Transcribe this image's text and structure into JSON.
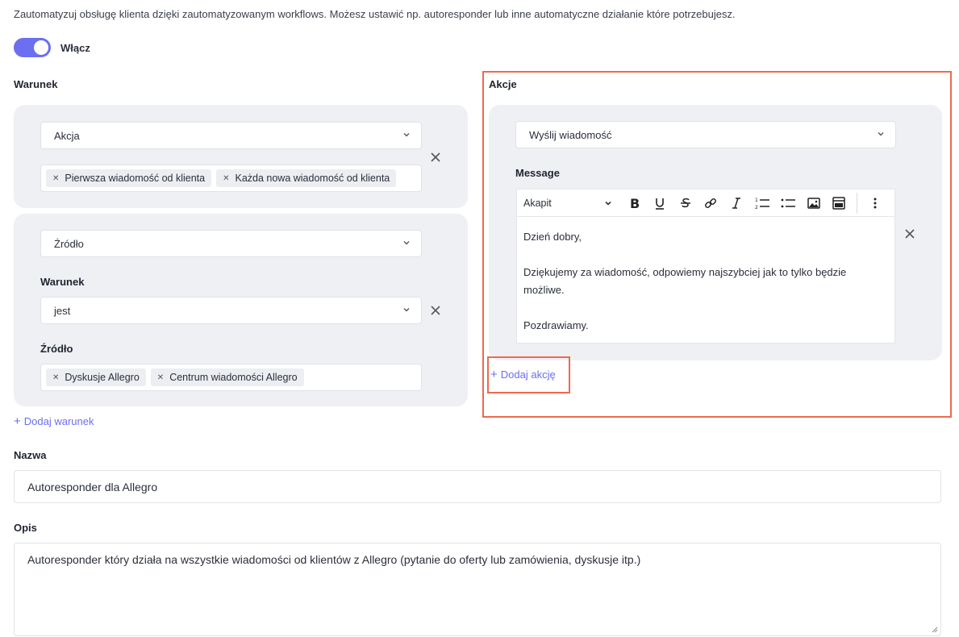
{
  "intro_text": "Zautomatyzuj obsługę klienta dzięki zautomatyzowanym workflows. Możesz ustawić np. autoresponder lub inne automatyczne działanie które potrzebujesz.",
  "toggle": {
    "label": "Włącz",
    "on": true
  },
  "conditions": {
    "title": "Warunek",
    "card1": {
      "select_value": "Akcja",
      "tags": [
        "Pierwsza wiadomość od klienta",
        "Każda nowa wiadomość od klienta"
      ]
    },
    "card2": {
      "select_value": "Źródło",
      "condition_label": "Warunek",
      "condition_value": "jest",
      "source_label": "Źródło",
      "tags": [
        "Dyskusje Allegro",
        "Centrum wiadomości Allegro"
      ]
    },
    "add_label": "Dodaj warunek"
  },
  "actions": {
    "title": "Akcje",
    "select_value": "Wyślij wiadomość",
    "message_label": "Message",
    "format_value": "Akapit",
    "message_lines": [
      "Dzień dobry,",
      "",
      "Dziękujemy za wiadomość, odpowiemy najszybciej jak to tylko będzie możliwe.",
      "",
      "Pozdrawiamy."
    ],
    "add_label": "Dodaj akcję"
  },
  "name": {
    "label": "Nazwa",
    "value": "Autoresponder dla Allegro"
  },
  "description": {
    "label": "Opis",
    "value": "Autoresponder który działa na wszystkie wiadomości od klientów z Allegro (pytanie do oferty lub zamówienia, dyskusje itp.)"
  },
  "colors": {
    "accent": "#6b6ff0",
    "highlight": "#ee6a4f",
    "card": "#eef0f4"
  }
}
